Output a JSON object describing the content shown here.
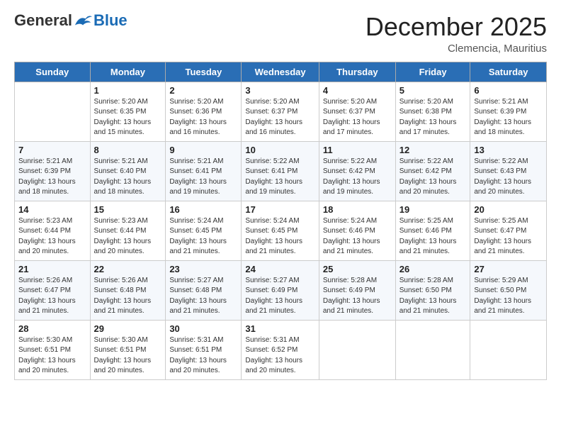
{
  "header": {
    "logo_general": "General",
    "logo_blue": "Blue",
    "month_title": "December 2025",
    "subtitle": "Clemencia, Mauritius"
  },
  "weekdays": [
    "Sunday",
    "Monday",
    "Tuesday",
    "Wednesday",
    "Thursday",
    "Friday",
    "Saturday"
  ],
  "weeks": [
    [
      {
        "num": "",
        "detail": ""
      },
      {
        "num": "1",
        "detail": "Sunrise: 5:20 AM\nSunset: 6:35 PM\nDaylight: 13 hours\nand 15 minutes."
      },
      {
        "num": "2",
        "detail": "Sunrise: 5:20 AM\nSunset: 6:36 PM\nDaylight: 13 hours\nand 16 minutes."
      },
      {
        "num": "3",
        "detail": "Sunrise: 5:20 AM\nSunset: 6:37 PM\nDaylight: 13 hours\nand 16 minutes."
      },
      {
        "num": "4",
        "detail": "Sunrise: 5:20 AM\nSunset: 6:37 PM\nDaylight: 13 hours\nand 17 minutes."
      },
      {
        "num": "5",
        "detail": "Sunrise: 5:20 AM\nSunset: 6:38 PM\nDaylight: 13 hours\nand 17 minutes."
      },
      {
        "num": "6",
        "detail": "Sunrise: 5:21 AM\nSunset: 6:39 PM\nDaylight: 13 hours\nand 18 minutes."
      }
    ],
    [
      {
        "num": "7",
        "detail": "Sunrise: 5:21 AM\nSunset: 6:39 PM\nDaylight: 13 hours\nand 18 minutes."
      },
      {
        "num": "8",
        "detail": "Sunrise: 5:21 AM\nSunset: 6:40 PM\nDaylight: 13 hours\nand 18 minutes."
      },
      {
        "num": "9",
        "detail": "Sunrise: 5:21 AM\nSunset: 6:41 PM\nDaylight: 13 hours\nand 19 minutes."
      },
      {
        "num": "10",
        "detail": "Sunrise: 5:22 AM\nSunset: 6:41 PM\nDaylight: 13 hours\nand 19 minutes."
      },
      {
        "num": "11",
        "detail": "Sunrise: 5:22 AM\nSunset: 6:42 PM\nDaylight: 13 hours\nand 19 minutes."
      },
      {
        "num": "12",
        "detail": "Sunrise: 5:22 AM\nSunset: 6:42 PM\nDaylight: 13 hours\nand 20 minutes."
      },
      {
        "num": "13",
        "detail": "Sunrise: 5:22 AM\nSunset: 6:43 PM\nDaylight: 13 hours\nand 20 minutes."
      }
    ],
    [
      {
        "num": "14",
        "detail": "Sunrise: 5:23 AM\nSunset: 6:44 PM\nDaylight: 13 hours\nand 20 minutes."
      },
      {
        "num": "15",
        "detail": "Sunrise: 5:23 AM\nSunset: 6:44 PM\nDaylight: 13 hours\nand 20 minutes."
      },
      {
        "num": "16",
        "detail": "Sunrise: 5:24 AM\nSunset: 6:45 PM\nDaylight: 13 hours\nand 21 minutes."
      },
      {
        "num": "17",
        "detail": "Sunrise: 5:24 AM\nSunset: 6:45 PM\nDaylight: 13 hours\nand 21 minutes."
      },
      {
        "num": "18",
        "detail": "Sunrise: 5:24 AM\nSunset: 6:46 PM\nDaylight: 13 hours\nand 21 minutes."
      },
      {
        "num": "19",
        "detail": "Sunrise: 5:25 AM\nSunset: 6:46 PM\nDaylight: 13 hours\nand 21 minutes."
      },
      {
        "num": "20",
        "detail": "Sunrise: 5:25 AM\nSunset: 6:47 PM\nDaylight: 13 hours\nand 21 minutes."
      }
    ],
    [
      {
        "num": "21",
        "detail": "Sunrise: 5:26 AM\nSunset: 6:47 PM\nDaylight: 13 hours\nand 21 minutes."
      },
      {
        "num": "22",
        "detail": "Sunrise: 5:26 AM\nSunset: 6:48 PM\nDaylight: 13 hours\nand 21 minutes."
      },
      {
        "num": "23",
        "detail": "Sunrise: 5:27 AM\nSunset: 6:48 PM\nDaylight: 13 hours\nand 21 minutes."
      },
      {
        "num": "24",
        "detail": "Sunrise: 5:27 AM\nSunset: 6:49 PM\nDaylight: 13 hours\nand 21 minutes."
      },
      {
        "num": "25",
        "detail": "Sunrise: 5:28 AM\nSunset: 6:49 PM\nDaylight: 13 hours\nand 21 minutes."
      },
      {
        "num": "26",
        "detail": "Sunrise: 5:28 AM\nSunset: 6:50 PM\nDaylight: 13 hours\nand 21 minutes."
      },
      {
        "num": "27",
        "detail": "Sunrise: 5:29 AM\nSunset: 6:50 PM\nDaylight: 13 hours\nand 21 minutes."
      }
    ],
    [
      {
        "num": "28",
        "detail": "Sunrise: 5:30 AM\nSunset: 6:51 PM\nDaylight: 13 hours\nand 20 minutes."
      },
      {
        "num": "29",
        "detail": "Sunrise: 5:30 AM\nSunset: 6:51 PM\nDaylight: 13 hours\nand 20 minutes."
      },
      {
        "num": "30",
        "detail": "Sunrise: 5:31 AM\nSunset: 6:51 PM\nDaylight: 13 hours\nand 20 minutes."
      },
      {
        "num": "31",
        "detail": "Sunrise: 5:31 AM\nSunset: 6:52 PM\nDaylight: 13 hours\nand 20 minutes."
      },
      {
        "num": "",
        "detail": ""
      },
      {
        "num": "",
        "detail": ""
      },
      {
        "num": "",
        "detail": ""
      }
    ]
  ]
}
